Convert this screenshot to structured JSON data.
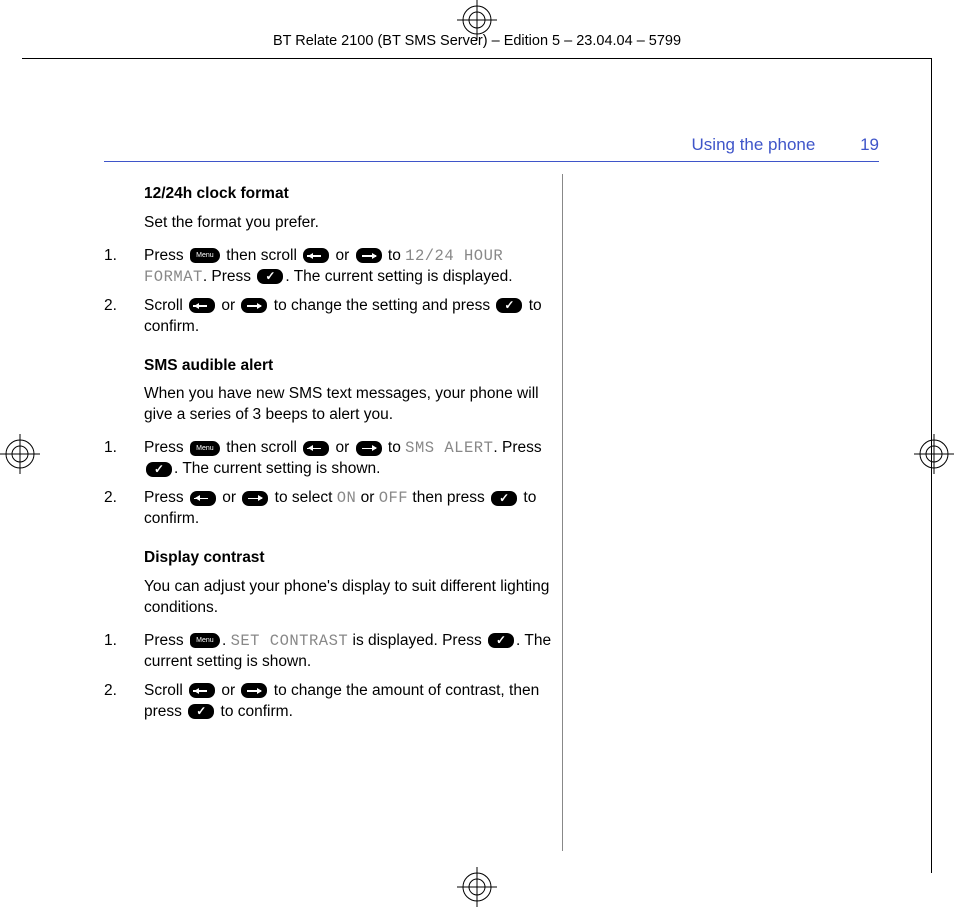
{
  "runningHeader": "BT Relate 2100 (BT SMS Server) – Edition 5 – 23.04.04 – 5799",
  "header": {
    "section": "Using the phone",
    "pageNumber": "19"
  },
  "s1": {
    "title": "12/24h clock format",
    "intro": "Set the format you prefer.",
    "step1": {
      "n": "1.",
      "a": "Press ",
      "b": " then scroll ",
      "c": " or ",
      "d": " to ",
      "lcd": "12/24 HOUR FORMAT",
      "e": ". Press ",
      "f": ". The current setting is displayed."
    },
    "step2": {
      "n": "2.",
      "a": "Scroll ",
      "b": " or ",
      "c": " to change the setting and press ",
      "d": " to confirm."
    }
  },
  "s2": {
    "title": "SMS audible alert",
    "intro": "When you have new SMS text messages, your phone will give a series of 3 beeps to alert you.",
    "step1": {
      "n": "1.",
      "a": "Press ",
      "b": " then scroll ",
      "c": " or ",
      "d": " to ",
      "lcd": "SMS ALERT",
      "e": ". Press ",
      "f": ". The current setting is shown."
    },
    "step2": {
      "n": "2.",
      "a": "Press ",
      "b": " or ",
      "c": " to select ",
      "lcdOn": "ON",
      "d": " or ",
      "lcdOff": "OFF",
      "e": " then press ",
      "f": " to confirm."
    }
  },
  "s3": {
    "title": "Display contrast",
    "intro": "You can adjust your phone's display to suit different lighting conditions.",
    "step1": {
      "n": "1.",
      "a": "Press ",
      "b": ". ",
      "lcd": "SET CONTRAST",
      "c": " is displayed. Press ",
      "d": ". The current setting is shown."
    },
    "step2": {
      "n": "2.",
      "a": "Scroll ",
      "b": " or ",
      "c": " to change the amount of contrast, then press ",
      "d": " to confirm."
    }
  }
}
